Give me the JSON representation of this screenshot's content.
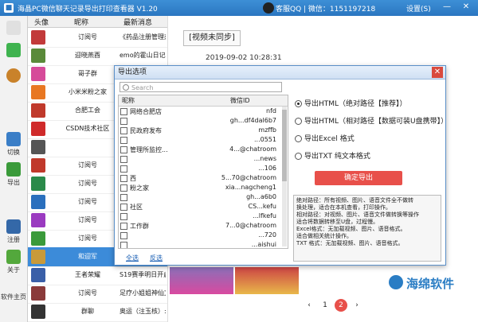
{
  "app": {
    "title": "海晶PC微信聊天记录导出打印查看器 V1.20",
    "qq_info": "客服QQ | 微信：1151197218",
    "settings_label": "设置(S)",
    "min": "—",
    "close": "✕"
  },
  "sidebar": {
    "items": [
      {
        "label": "",
        "icon": "chat-icon",
        "color": "#3fb34f"
      },
      {
        "label": "",
        "icon": "contacts-icon",
        "color": "#c9822a"
      },
      {
        "label": "切换",
        "icon": "switch-icon",
        "color": "#3a7ec7"
      },
      {
        "label": "导出",
        "icon": "export-icon",
        "color": "#3a9a3a"
      },
      {
        "label": "注册",
        "icon": "register-icon",
        "color": "#3468a8"
      },
      {
        "label": "关于",
        "icon": "about-icon",
        "color": "#53a83c"
      },
      {
        "label": "软件主页",
        "icon": "home-icon",
        "color": ""
      }
    ]
  },
  "contacts": {
    "headers": {
      "avatar": "头像",
      "nickname": "昵称",
      "latest": "最新消息"
    },
    "rows": [
      {
        "name": "订阅号",
        "msg": "《药品注册管理办法",
        "color": "#c23a3a"
      },
      {
        "name": "迎晓燕酉",
        "msg": "emo的霍山日记",
        "color": "#5a8a3a"
      },
      {
        "name": "哥子群",
        "msg": "",
        "color": "#d64b9a"
      },
      {
        "name": "小米米粉之家",
        "msg": "",
        "color": "#e87722"
      },
      {
        "name": "合肥工会",
        "msg": "20",
        "color": "#c0392b"
      },
      {
        "name": "CSDN技术社区",
        "msg": "",
        "color": "#cf2a2a"
      },
      {
        "name": "",
        "msg": "",
        "color": "#555"
      },
      {
        "name": "订阅号",
        "msg": "",
        "color": "#c0392b"
      },
      {
        "name": "订阅号",
        "msg": "",
        "color": "#2a8a4a"
      },
      {
        "name": "订阅号",
        "msg": "",
        "color": "#2a6fbd"
      },
      {
        "name": "订阅号",
        "msg": "",
        "color": "#9a3ac0"
      },
      {
        "name": "订阅号",
        "msg": "",
        "color": "#3a9a3a"
      },
      {
        "name": "和迎军",
        "msg": "",
        "color": "#c99a3a"
      },
      {
        "name": "王者荣耀",
        "msg": "S19赛季明日开启",
        "color": "#3a5fa8"
      },
      {
        "name": "订阅号",
        "msg": "足疗小姐姐神仙文",
        "color": "#8a3a3a"
      },
      {
        "name": "群聊",
        "msg": "奥运（注玉核）:",
        "color": "#333"
      }
    ],
    "selected_index": 12
  },
  "messages": {
    "video_label": "[视频未同步]",
    "meta": "2019-09-02 10:28:31"
  },
  "pager": {
    "prev": "‹",
    "pages": [
      "1",
      "2"
    ],
    "current": "2",
    "next": "›"
  },
  "dialog": {
    "title": "导出选项",
    "close": "✕",
    "search_placeholder": "Search",
    "table_headers": {
      "nickname": "昵称",
      "wechat_id": "微信ID"
    },
    "rows": [
      {
        "name": "网络合肥店",
        "id": "nfd"
      },
      {
        "name": "",
        "id": "gh...df4dal6b7"
      },
      {
        "name": "民政府发布",
        "id": "mzffb"
      },
      {
        "name": "",
        "id": "...0551"
      },
      {
        "name": "管理所监控...",
        "id": "4...@chatroom"
      },
      {
        "name": "",
        "id": "...news"
      },
      {
        "name": "",
        "id": "...106"
      },
      {
        "name": "西",
        "id": "5...70@chatroom"
      },
      {
        "name": "粉之家",
        "id": "xia...nagcheng1"
      },
      {
        "name": "",
        "id": "gh...a6b0"
      },
      {
        "name": "社区",
        "id": "CS...kefu"
      },
      {
        "name": "",
        "id": "...lfkefu"
      },
      {
        "name": "工作群",
        "id": "7...0@chatroom"
      },
      {
        "name": "",
        "id": "...720"
      },
      {
        "name": "",
        "id": "...aishui"
      },
      {
        "name": "",
        "id": "...land"
      },
      {
        "name": "",
        "id": "...huan"
      }
    ],
    "select_all": "全选",
    "invert": "反选",
    "options": [
      {
        "label": "导出HTML（绝对路径【推荐】）",
        "selected": true
      },
      {
        "label": "导出HTML（相对路径【数据可装U盘携带】）",
        "selected": false
      },
      {
        "label": "导出Excel 格式",
        "selected": false
      },
      {
        "label": "导出TXT 纯文本格式",
        "selected": false
      }
    ],
    "export_button": "确定导出",
    "notes": [
      "绝对路径：所有视频、图片、语音文件全不做转",
      "          换处理，适合在本机查看，打印操作。",
      "相对路径：对视频、图片、语音文件做转换等操作",
      "          适合将数据转移至U盘，过程慢。",
      "Excel格式：无加载视频、图片、语音格式。",
      "          适合做相关统计操作。",
      "TXT 格式：无加载视频、图片、语音格式。"
    ]
  },
  "watermark": "海绵软件",
  "colors": {
    "accent": "#2a76c0",
    "export": "#e8504a",
    "selected_row": "#3c8bd9"
  }
}
